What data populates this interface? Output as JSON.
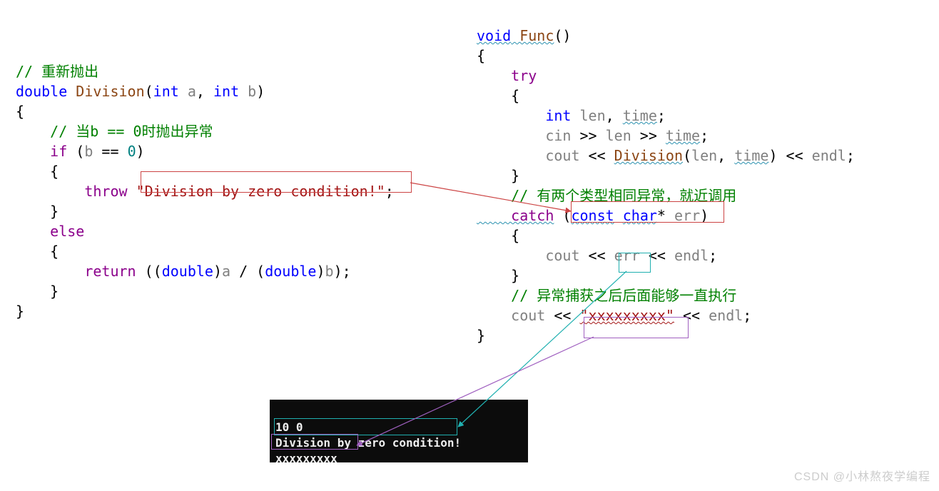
{
  "left": {
    "c1": "// 重新抛出",
    "l2_double": "double",
    "l2_func": " Division",
    "l2_open": "(",
    "l2_int1": "int",
    "l2_a": " a",
    "l2_comma": ", ",
    "l2_int2": "int",
    "l2_b": " b",
    "l2_close": ")",
    "l3": "{",
    "c2": "    // 当b == 0时抛出异常",
    "l5_if": "    if",
    "l5_open": " (",
    "l5_b": "b",
    "l5_eq": " == ",
    "l5_zero": "0",
    "l5_close": ")",
    "l6": "    {",
    "l7_throw": "        throw",
    "l7_sp": " ",
    "l7_str": "\"Division by zero condition!\"",
    "l7_semi": ";",
    "l8": "    }",
    "l9_else": "    else",
    "l10": "    {",
    "l11_return": "        return",
    "l11_a": " ((",
    "l11_double1": "double",
    "l11_b1": ")",
    "l11_var_a": "a",
    "l11_div": " / (",
    "l11_double2": "double",
    "l11_b2": ")",
    "l11_var_b": "b",
    "l11_end": ");",
    "l12": "    }",
    "l13": "}"
  },
  "right": {
    "r1_void": "void",
    "r1_func": " Func",
    "r1_par": "()",
    "r2": "{",
    "r3_try": "    try",
    "r4": "    {",
    "r5_int": "        int",
    "r5_len": " len",
    "r5_comma": ", ",
    "r5_time": "time",
    "r5_semi": ";",
    "r6_cin": "        cin",
    "r6_op1": " >> ",
    "r6_len": "len",
    "r6_op2": " >> ",
    "r6_time": "time",
    "r6_semi": ";",
    "r7_cout": "        cout",
    "r7_op1": " << ",
    "r7_div": "Division",
    "r7_open": "(",
    "r7_len": "len",
    "r7_comma": ", ",
    "r7_time": "time",
    "r7_close": ")",
    "r7_op2": " << ",
    "r7_endl": "endl",
    "r7_semi": ";",
    "r8": "    }",
    "c3": "    // 有两个类型相同异常，就近调用",
    "r10_catch": "    catch",
    "r10_open": " (",
    "r10_const": "const",
    "r10_sp": " ",
    "r10_char": "char",
    "r10_star": "* ",
    "r10_err": "err",
    "r10_close": ")",
    "r11": "    {",
    "r12_cout": "        cout",
    "r12_op1": " << ",
    "r12_err": "err",
    "r12_op2": " << ",
    "r12_endl": "endl",
    "r12_semi": ";",
    "r13": "    }",
    "c4": "    // 异常捕获之后后面能够一直执行",
    "r15_cout": "    cout",
    "r15_op1": " << ",
    "r15_str": "\"xxxxxxxxx\"",
    "r15_op2": " << ",
    "r15_endl": "endl",
    "r15_semi": ";",
    "r16": "}"
  },
  "console": {
    "line1": "10 0",
    "line2": "Division by zero condition!",
    "line3": "xxxxxxxxx"
  },
  "watermark": "CSDN @小林熬夜学编程"
}
